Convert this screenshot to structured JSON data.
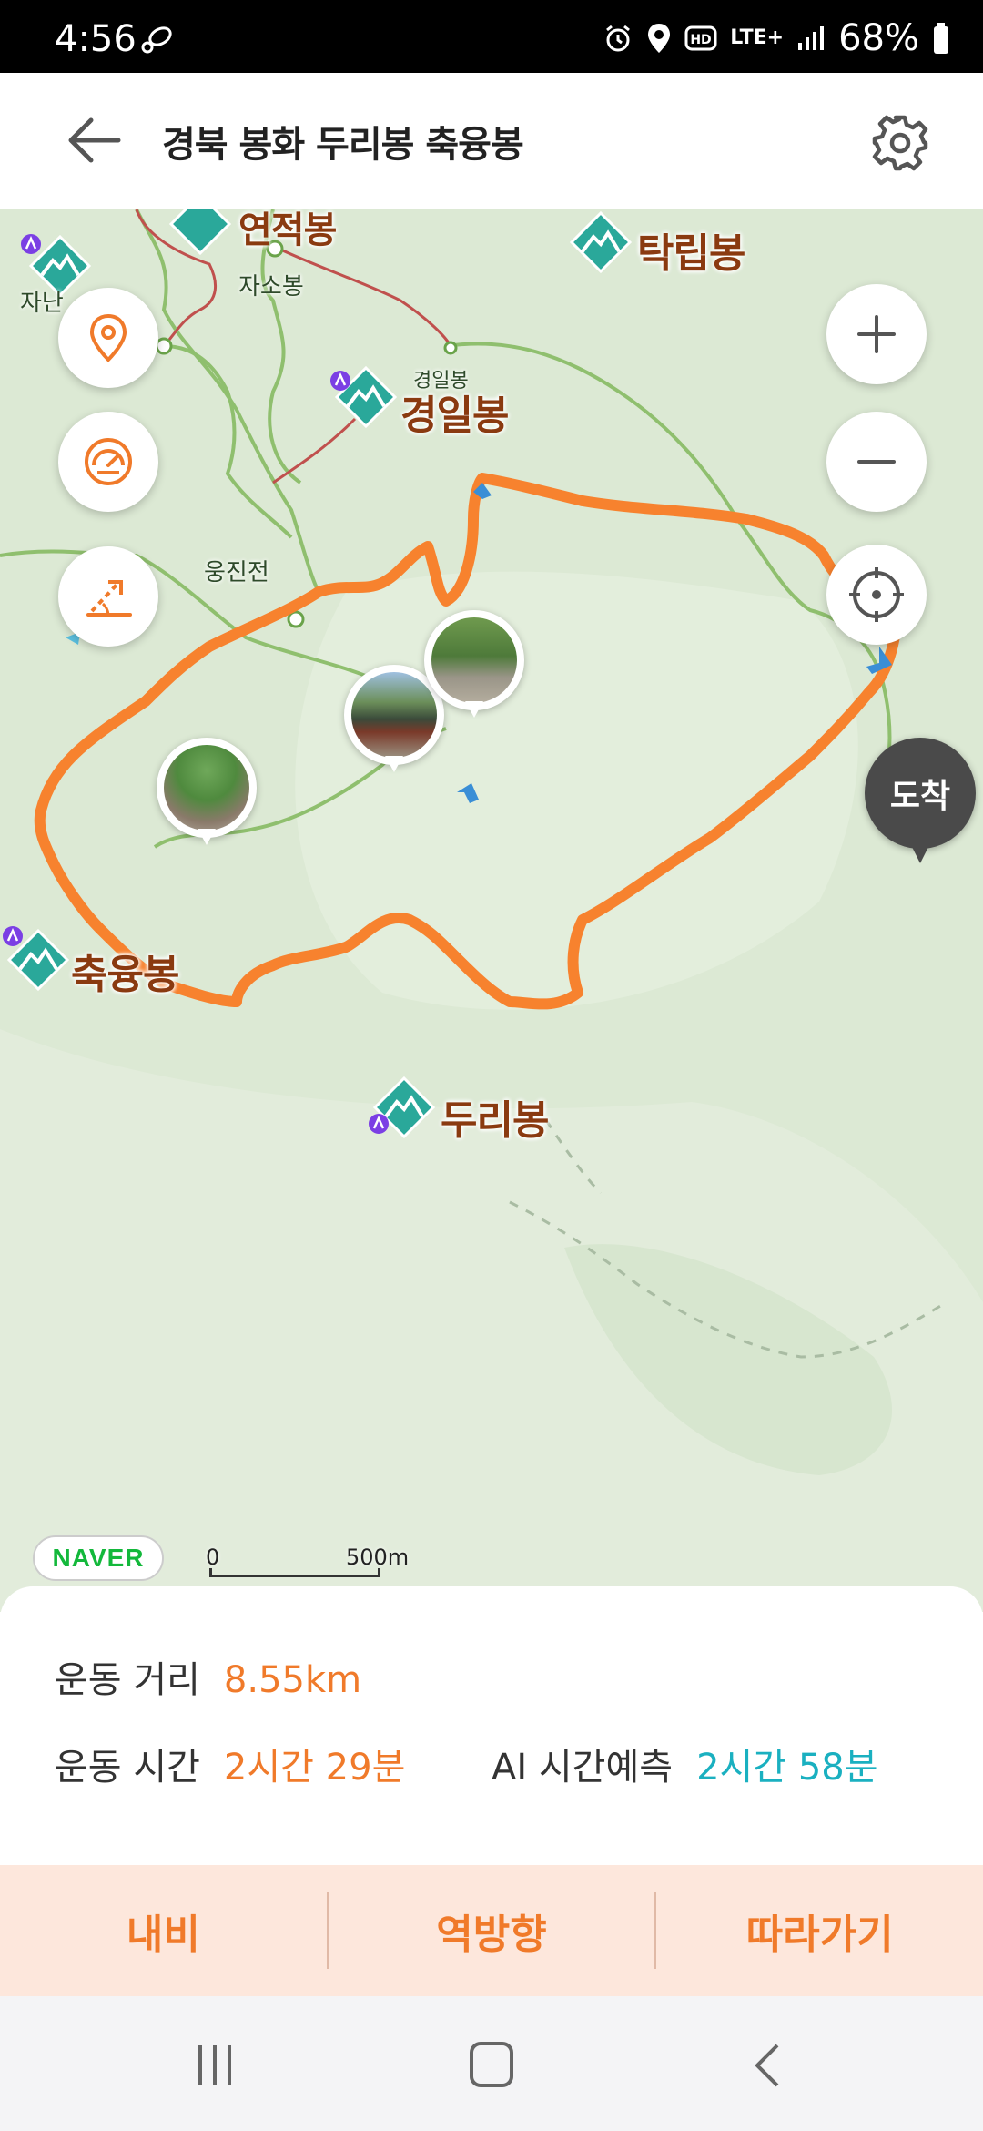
{
  "status_bar": {
    "time": "4:56",
    "network": "LTE+",
    "battery": "68%"
  },
  "header": {
    "title": "경북 봉화 두리봉 축융봉",
    "back_icon": "back-arrow-icon",
    "settings_icon": "gear-icon"
  },
  "map": {
    "peaks": {
      "taklip": "탁립봉",
      "gyeongil": "경일봉",
      "chukyung": "축융봉",
      "duri": "두리봉",
      "top_partial": "연적봉"
    },
    "small_labels": {
      "jaso": "자소봉",
      "ungjin": "웅진전",
      "gyeongil_small": "경일봉",
      "left_partial": "자난"
    },
    "arrive_label": "도착",
    "logo": "NAVER",
    "scale": {
      "start": "0",
      "distance": "500m"
    },
    "route_color": "#f7822e",
    "controls": {
      "location_pin_icon": "location-pin-icon",
      "speed_icon": "speedometer-icon",
      "elevation_icon": "elevation-icon",
      "zoom_in_icon": "plus-icon",
      "zoom_out_icon": "minus-icon",
      "recenter_icon": "crosshair-icon"
    }
  },
  "stats": {
    "distance_label": "운동 거리",
    "distance_value": "8.55km",
    "time_label": "운동 시간",
    "time_value": "2시간 29분",
    "ai_label": "AI 시간예측",
    "ai_value": "2시간 58분"
  },
  "actions": {
    "navi": "내비",
    "reverse": "역방향",
    "follow": "따라가기"
  },
  "colors": {
    "accent": "#f07a2a",
    "teal": "#1ab0c0",
    "peak_marker": "#2aa89a"
  }
}
